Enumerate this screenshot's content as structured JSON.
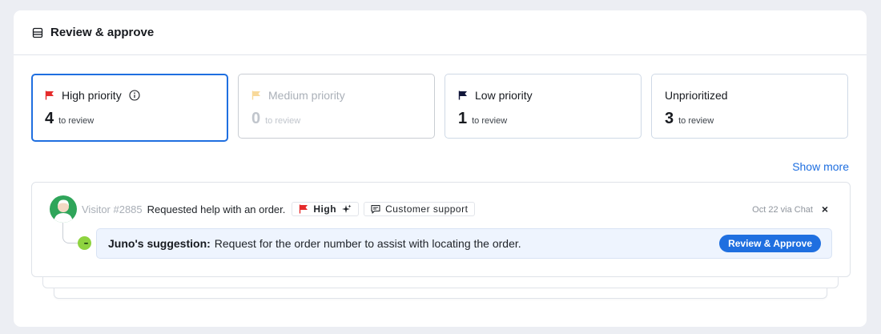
{
  "header": {
    "title": "Review & approve",
    "icon": "inbox-icon"
  },
  "cards": [
    {
      "label": "High priority",
      "count": "4",
      "sub": "to review",
      "flag_color": "#e52b2b",
      "state": "selected",
      "info_icon": "info-icon"
    },
    {
      "label": "Medium priority",
      "count": "0",
      "sub": "to review",
      "flag_color": "#f8d99a",
      "state": "disabled"
    },
    {
      "label": "Low priority",
      "count": "1",
      "sub": "to review",
      "flag_color": "#11163a",
      "state": "default"
    },
    {
      "label": "Unprioritized",
      "count": "3",
      "sub": "to review",
      "state": "default"
    }
  ],
  "show_more": "Show more",
  "conversation": {
    "visitor": "Visitor #2885",
    "summary": "Requested help with an order.",
    "priority_chip": "High",
    "topic_chip": "Customer support",
    "meta": "Oct 22 via Chat",
    "close": "×",
    "suggestion_label": "Juno's suggestion:",
    "suggestion_text": "Request for the order number to assist with locating the order.",
    "approve_button": "Review & Approve"
  },
  "colors": {
    "accent": "#1f6fe0",
    "avatar": "#2fa55a",
    "bot_avatar": "#8ed33f",
    "suggestion_bg": "#eef4fe"
  }
}
